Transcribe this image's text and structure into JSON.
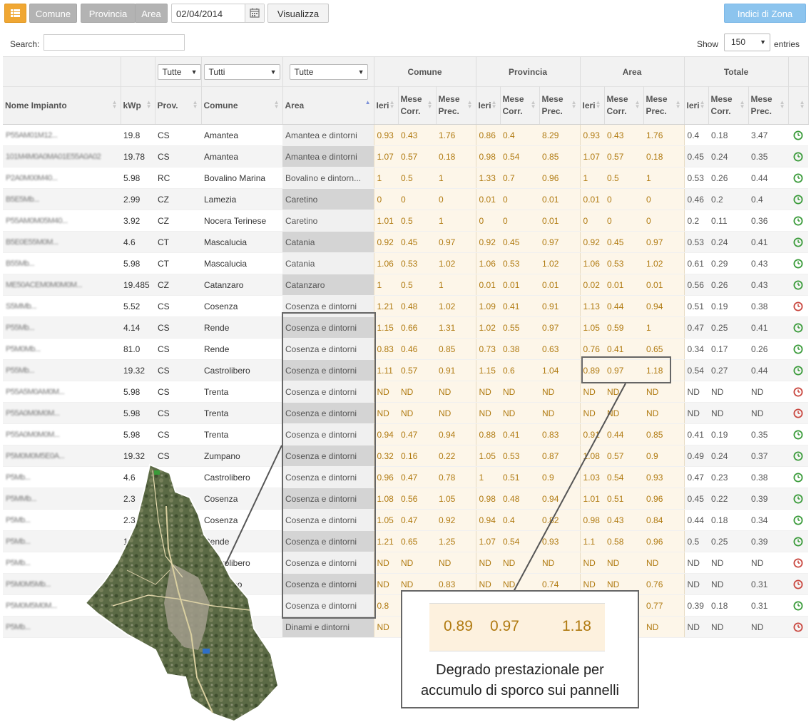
{
  "toolbar": {
    "comune_label": "Comune",
    "provincia_label": "Provincia",
    "area_label": "Area",
    "date_value": "02/04/2014",
    "view_label": "Visualizza",
    "zone_label": "Indici di Zona"
  },
  "search": {
    "label": "Search:",
    "value": ""
  },
  "show": {
    "label": "Show",
    "value": "150",
    "suffix": "entries"
  },
  "filters": {
    "prov": "Tutte",
    "comune": "Tutti",
    "area": "Tutte"
  },
  "groups": {
    "comune": "Comune",
    "provincia": "Provincia",
    "area": "Area",
    "totale": "Totale"
  },
  "columns": {
    "name": "Nome Impianto",
    "kwp": "kWp",
    "prov": "Prov.",
    "comune": "Comune",
    "area": "Area",
    "ieri": "Ieri",
    "mese_corr": "Mese Corr.",
    "mese_prec": "Mese Prec."
  },
  "rows": [
    {
      "name": "P55AM01M12...",
      "kwp": "19.8",
      "prov": "CS",
      "comune": "Amantea",
      "area": "Amantea e dintorni",
      "v": [
        "0.93",
        "0.43",
        "1.76",
        "0.86",
        "0.4",
        "8.29",
        "0.93",
        "0.43",
        "1.76",
        "0.4",
        "0.18",
        "3.47"
      ],
      "status": "ok"
    },
    {
      "name": "101M4M0A0MA01E55A0A02",
      "kwp": "19.78",
      "prov": "CS",
      "comune": "Amantea",
      "area": "Amantea e dintorni",
      "v": [
        "1.07",
        "0.57",
        "0.18",
        "0.98",
        "0.54",
        "0.85",
        "1.07",
        "0.57",
        "0.18",
        "0.45",
        "0.24",
        "0.35"
      ],
      "status": "ok"
    },
    {
      "name": "P2A0M00M40...",
      "kwp": "5.98",
      "prov": "RC",
      "comune": "Bovalino Marina",
      "area": "Bovalino e dintorn...",
      "v": [
        "1",
        "0.5",
        "1",
        "1.33",
        "0.7",
        "0.96",
        "1",
        "0.5",
        "1",
        "0.53",
        "0.26",
        "0.44"
      ],
      "status": "ok"
    },
    {
      "name": "B5E5Mb...",
      "kwp": "2.99",
      "prov": "CZ",
      "comune": "Lamezia",
      "area": "Caretino",
      "v": [
        "0",
        "0",
        "0",
        "0.01",
        "0",
        "0.01",
        "0.01",
        "0",
        "0",
        "0.46",
        "0.2",
        "0.4"
      ],
      "status": "ok"
    },
    {
      "name": "P55AM0M05M40...",
      "kwp": "3.92",
      "prov": "CZ",
      "comune": "Nocera Terinese",
      "area": "Caretino",
      "v": [
        "1.01",
        "0.5",
        "1",
        "0",
        "0",
        "0.01",
        "0",
        "0",
        "0",
        "0.2",
        "0.11",
        "0.36"
      ],
      "status": "ok"
    },
    {
      "name": "B5E0E55M0M...",
      "kwp": "4.6",
      "prov": "CT",
      "comune": "Mascalucia",
      "area": "Catania",
      "v": [
        "0.92",
        "0.45",
        "0.97",
        "0.92",
        "0.45",
        "0.97",
        "0.92",
        "0.45",
        "0.97",
        "0.53",
        "0.24",
        "0.41"
      ],
      "status": "ok"
    },
    {
      "name": "B55Mb...",
      "kwp": "5.98",
      "prov": "CT",
      "comune": "Mascalucia",
      "area": "Catania",
      "v": [
        "1.06",
        "0.53",
        "1.02",
        "1.06",
        "0.53",
        "1.02",
        "1.06",
        "0.53",
        "1.02",
        "0.61",
        "0.29",
        "0.43"
      ],
      "status": "ok"
    },
    {
      "name": "ME50ACEM0M0M0M...",
      "kwp": "19.485",
      "prov": "CZ",
      "comune": "Catanzaro",
      "area": "Catanzaro",
      "v": [
        "1",
        "0.5",
        "1",
        "0.01",
        "0.01",
        "0.01",
        "0.02",
        "0.01",
        "0.01",
        "0.56",
        "0.26",
        "0.43"
      ],
      "status": "ok"
    },
    {
      "name": "S5MMb...",
      "kwp": "5.52",
      "prov": "CS",
      "comune": "Cosenza",
      "area": "Cosenza e dintorni",
      "v": [
        "1.21",
        "0.48",
        "1.02",
        "1.09",
        "0.41",
        "0.91",
        "1.13",
        "0.44",
        "0.94",
        "0.51",
        "0.19",
        "0.38"
      ],
      "status": "warn"
    },
    {
      "name": "P55Mb...",
      "kwp": "4.14",
      "prov": "CS",
      "comune": "Rende",
      "area": "Cosenza e dintorni",
      "v": [
        "1.15",
        "0.66",
        "1.31",
        "1.02",
        "0.55",
        "0.97",
        "1.05",
        "0.59",
        "1",
        "0.47",
        "0.25",
        "0.41"
      ],
      "status": "ok"
    },
    {
      "name": "P5M0Mb...",
      "kwp": "81.0",
      "prov": "CS",
      "comune": "Rende",
      "area": "Cosenza e dintorni",
      "v": [
        "0.83",
        "0.46",
        "0.85",
        "0.73",
        "0.38",
        "0.63",
        "0.76",
        "0.41",
        "0.65",
        "0.34",
        "0.17",
        "0.26"
      ],
      "status": "ok"
    },
    {
      "name": "P55Mb...",
      "kwp": "19.32",
      "prov": "CS",
      "comune": "Castrolibero",
      "area": "Cosenza e dintorni",
      "v": [
        "1.11",
        "0.57",
        "0.91",
        "1.15",
        "0.6",
        "1.04",
        "0.89",
        "0.97",
        "1.18",
        "0.54",
        "0.27",
        "0.44"
      ],
      "status": "ok"
    },
    {
      "name": "P55A5M0AM0M...",
      "kwp": "5.98",
      "prov": "CS",
      "comune": "Trenta",
      "area": "Cosenza e dintorni",
      "v": [
        "ND",
        "ND",
        "ND",
        "ND",
        "ND",
        "ND",
        "ND",
        "ND",
        "ND",
        "ND",
        "ND",
        "ND"
      ],
      "status": "warn"
    },
    {
      "name": "P55A0M0M0M...",
      "kwp": "5.98",
      "prov": "CS",
      "comune": "Trenta",
      "area": "Cosenza e dintorni",
      "v": [
        "ND",
        "ND",
        "ND",
        "ND",
        "ND",
        "ND",
        "ND",
        "ND",
        "ND",
        "ND",
        "ND",
        "ND"
      ],
      "status": "warn"
    },
    {
      "name": "P55A0M0M0M...",
      "kwp": "5.98",
      "prov": "CS",
      "comune": "Trenta",
      "area": "Cosenza e dintorni",
      "v": [
        "0.94",
        "0.47",
        "0.94",
        "0.88",
        "0.41",
        "0.83",
        "0.91",
        "0.44",
        "0.85",
        "0.41",
        "0.19",
        "0.35"
      ],
      "status": "ok"
    },
    {
      "name": "P5M0M0M5E0A...",
      "kwp": "19.32",
      "prov": "CS",
      "comune": "Zumpano",
      "area": "Cosenza e dintorni",
      "v": [
        "0.32",
        "0.16",
        "0.22",
        "1.05",
        "0.53",
        "0.87",
        "1.08",
        "0.57",
        "0.9",
        "0.49",
        "0.24",
        "0.37"
      ],
      "status": "ok"
    },
    {
      "name": "P5Mb...",
      "kwp": "4.6",
      "prov": "CS",
      "comune": "Castrolibero",
      "area": "Cosenza e dintorni",
      "v": [
        "0.96",
        "0.47",
        "0.78",
        "1",
        "0.51",
        "0.9",
        "1.03",
        "0.54",
        "0.93",
        "0.47",
        "0.23",
        "0.38"
      ],
      "status": "ok"
    },
    {
      "name": "P5MMb...",
      "kwp": "2.3",
      "prov": "CS",
      "comune": "Cosenza",
      "area": "Cosenza e dintorni",
      "v": [
        "1.08",
        "0.56",
        "1.05",
        "0.98",
        "0.48",
        "0.94",
        "1.01",
        "0.51",
        "0.96",
        "0.45",
        "0.22",
        "0.39"
      ],
      "status": "ok"
    },
    {
      "name": "P5Mb...",
      "kwp": "2.3",
      "prov": "CS",
      "comune": "Cosenza",
      "area": "Cosenza e dintorni",
      "v": [
        "1.05",
        "0.47",
        "0.92",
        "0.94",
        "0.4",
        "0.82",
        "0.98",
        "0.43",
        "0.84",
        "0.44",
        "0.18",
        "0.34"
      ],
      "status": "ok"
    },
    {
      "name": "P5Mb...",
      "kwp": "1",
      "prov": "CS",
      "comune": "Rende",
      "area": "Cosenza e dintorni",
      "v": [
        "1.21",
        "0.65",
        "1.25",
        "1.07",
        "0.54",
        "0.93",
        "1.1",
        "0.58",
        "0.96",
        "0.5",
        "0.25",
        "0.39"
      ],
      "status": "ok"
    },
    {
      "name": "P5Mb...",
      "kwp": "",
      "prov": "",
      "comune": "Castrolibero",
      "area": "Cosenza e dintorni",
      "v": [
        "ND",
        "ND",
        "ND",
        "ND",
        "ND",
        "ND",
        "ND",
        "ND",
        "ND",
        "ND",
        "ND",
        "ND"
      ],
      "status": "warn"
    },
    {
      "name": "P5M0M5Mb...",
      "kwp": "",
      "prov": "",
      "comune": "Rendicino",
      "area": "Cosenza e dintorni",
      "v": [
        "ND",
        "ND",
        "0.83",
        "ND",
        "ND",
        "0.74",
        "ND",
        "ND",
        "0.76",
        "ND",
        "ND",
        "0.31"
      ],
      "status": "warn"
    },
    {
      "name": "P5M0M5M0M...",
      "kwp": "",
      "prov": "",
      "comune": "Castrolibero",
      "area": "Cosenza e dintorni",
      "v": [
        "0.8",
        "",
        "",
        "",
        "",
        "",
        "",
        "",
        "0.77",
        "0.39",
        "0.18",
        "0.31"
      ],
      "status": "ok"
    },
    {
      "name": "P5Mb...",
      "kwp": "",
      "prov": "",
      "comune": "",
      "area": "Dinami e dintorni",
      "v": [
        "ND",
        "",
        "",
        "",
        "",
        "",
        "",
        "",
        "ND",
        "ND",
        "ND",
        "ND"
      ],
      "status": "warn"
    }
  ],
  "callout": {
    "values": [
      "0.89",
      "0.97",
      "1.18"
    ],
    "line1": "Degrado prestazionale per",
    "line2": "accumulo di sporco sui pannelli"
  },
  "colors": {
    "ok": "#3a9b3a",
    "warn": "#c9473f",
    "accent": "#f0a733"
  }
}
